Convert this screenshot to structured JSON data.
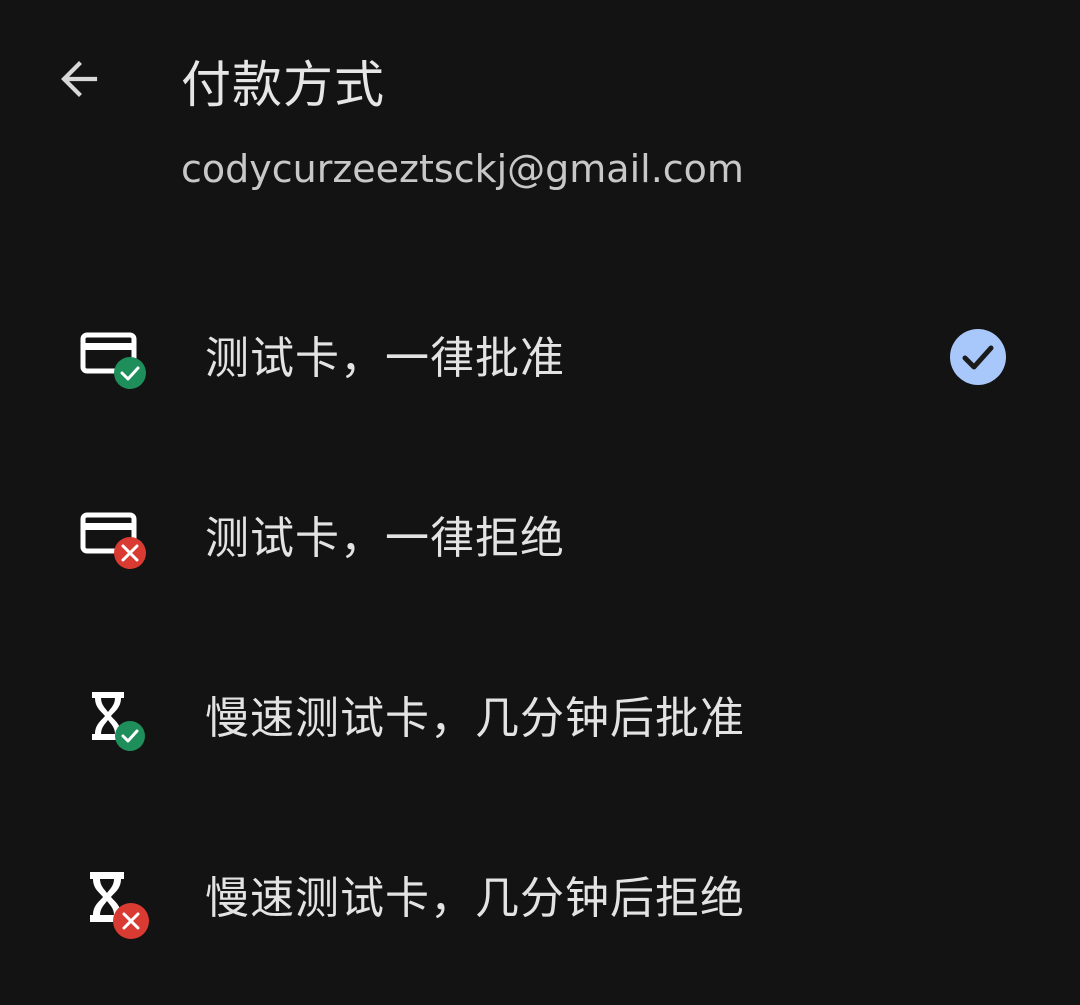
{
  "header": {
    "back_icon": "arrow-back-icon",
    "title": "付款方式",
    "email": "codycurzeeztsckj@gmail.com"
  },
  "options": [
    {
      "label": "测试卡，一律批准",
      "icon": "credit-card-approve-icon",
      "selected": true
    },
    {
      "label": "测试卡，一律拒绝",
      "icon": "credit-card-decline-icon",
      "selected": false
    },
    {
      "label": "慢速测试卡，几分钟后批准",
      "icon": "hourglass-approve-icon",
      "selected": false
    },
    {
      "label": "慢速测试卡，几分钟后拒绝",
      "icon": "hourglass-decline-icon",
      "selected": false
    }
  ],
  "colors": {
    "background": "#131313",
    "text": "#e3e3e3",
    "approve_badge": "#1e8e5a",
    "decline_badge": "#d93a32",
    "selected_check_bg": "#a8c7fa",
    "selected_check_fg": "#1b1b1b"
  }
}
